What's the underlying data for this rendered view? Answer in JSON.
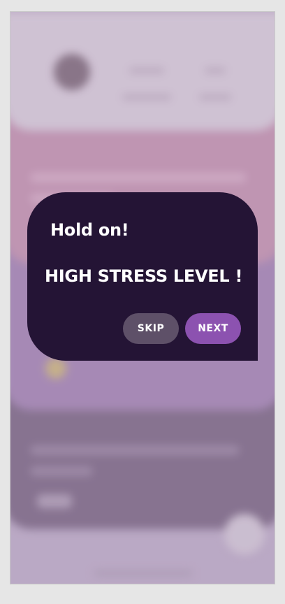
{
  "dialog": {
    "title": "Hold on!",
    "message": "HIGH STRESS LEVEL !",
    "skip_label": "SKIP",
    "next_label": "NEXT"
  },
  "colors": {
    "dialog_background": "#241435",
    "skip_button": "#5e5068",
    "next_button": "#8c52b0",
    "text": "#ffffff"
  }
}
